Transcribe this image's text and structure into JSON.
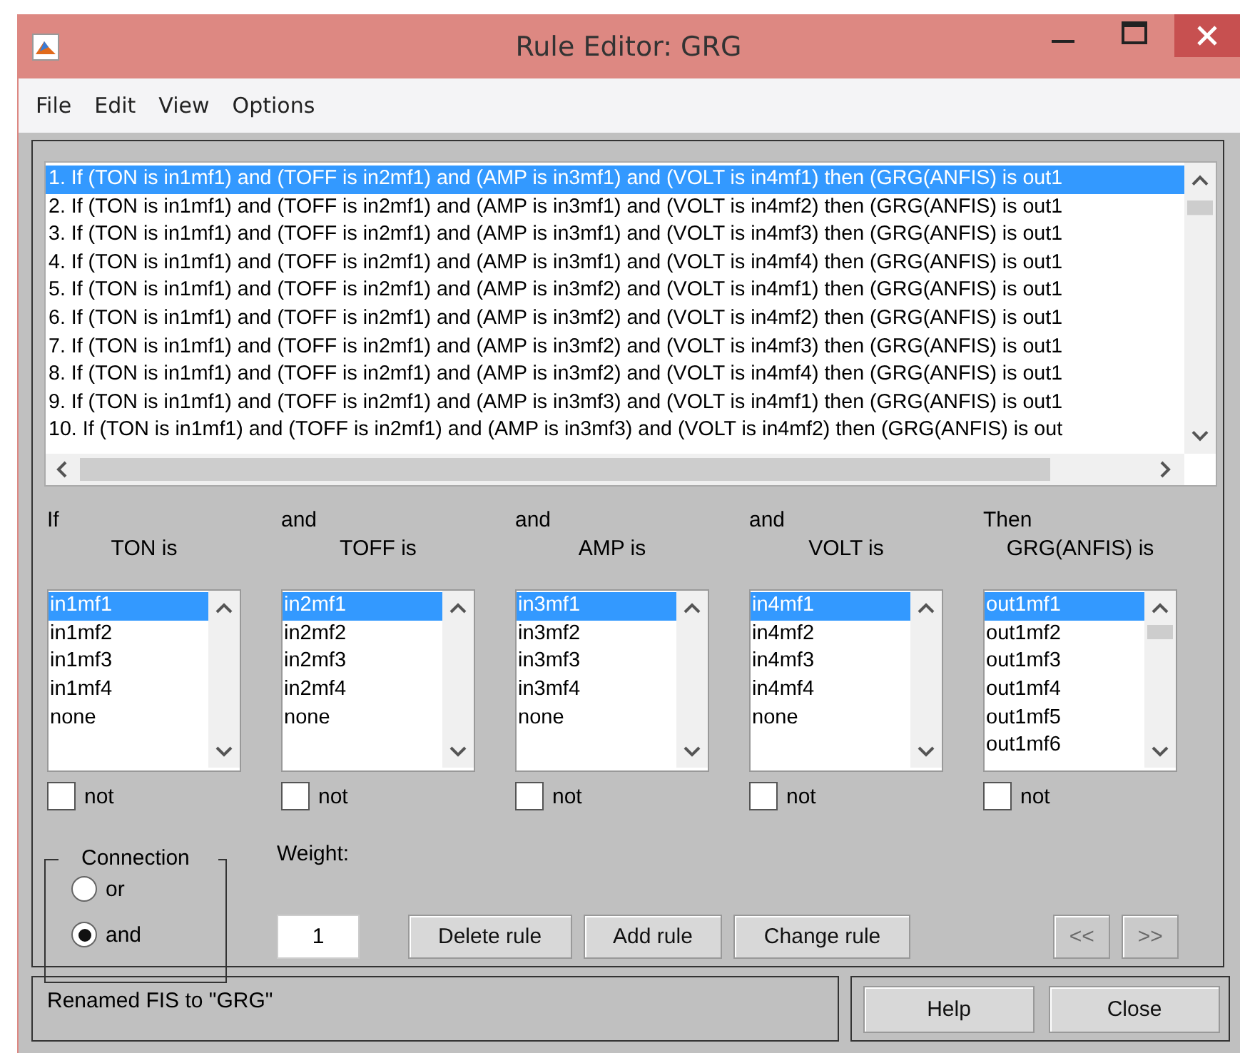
{
  "window": {
    "title": "Rule Editor: GRG"
  },
  "menu": [
    "File",
    "Edit",
    "View",
    "Options"
  ],
  "rules": [
    {
      "text": "1. If (TON is in1mf1) and (TOFF is in2mf1) and (AMP is in3mf1) and (VOLT is in4mf1) then (GRG(ANFIS) is out1",
      "selected": true
    },
    {
      "text": "2. If (TON is in1mf1) and (TOFF is in2mf1) and (AMP is in3mf1) and (VOLT is in4mf2) then (GRG(ANFIS) is out1",
      "selected": false
    },
    {
      "text": "3. If (TON is in1mf1) and (TOFF is in2mf1) and (AMP is in3mf1) and (VOLT is in4mf3) then (GRG(ANFIS) is out1",
      "selected": false
    },
    {
      "text": "4. If (TON is in1mf1) and (TOFF is in2mf1) and (AMP is in3mf1) and (VOLT is in4mf4) then (GRG(ANFIS) is out1",
      "selected": false
    },
    {
      "text": "5. If (TON is in1mf1) and (TOFF is in2mf1) and (AMP is in3mf2) and (VOLT is in4mf1) then (GRG(ANFIS) is out1",
      "selected": false
    },
    {
      "text": "6. If (TON is in1mf1) and (TOFF is in2mf1) and (AMP is in3mf2) and (VOLT is in4mf2) then (GRG(ANFIS) is out1",
      "selected": false
    },
    {
      "text": "7. If (TON is in1mf1) and (TOFF is in2mf1) and (AMP is in3mf2) and (VOLT is in4mf3) then (GRG(ANFIS) is out1",
      "selected": false
    },
    {
      "text": "8. If (TON is in1mf1) and (TOFF is in2mf1) and (AMP is in3mf2) and (VOLT is in4mf4) then (GRG(ANFIS) is out1",
      "selected": false
    },
    {
      "text": "9. If (TON is in1mf1) and (TOFF is in2mf1) and (AMP is in3mf3) and (VOLT is in4mf1) then (GRG(ANFIS) is out1",
      "selected": false
    },
    {
      "text": "10. If (TON is in1mf1) and (TOFF is in2mf1) and (AMP is in3mf3) and (VOLT is in4mf2) then (GRG(ANFIS) is out",
      "selected": false
    }
  ],
  "variables": [
    {
      "connector": "If",
      "label": "TON is",
      "items": [
        {
          "label": "in1mf1",
          "selected": true
        },
        {
          "label": "in1mf2",
          "selected": false
        },
        {
          "label": "in1mf3",
          "selected": false
        },
        {
          "label": "in1mf4",
          "selected": false
        },
        {
          "label": "none",
          "selected": false
        }
      ],
      "not": {
        "label": "not",
        "checked": false
      }
    },
    {
      "connector": "and",
      "label": "TOFF is",
      "items": [
        {
          "label": "in2mf1",
          "selected": true
        },
        {
          "label": "in2mf2",
          "selected": false
        },
        {
          "label": "in2mf3",
          "selected": false
        },
        {
          "label": "in2mf4",
          "selected": false
        },
        {
          "label": "none",
          "selected": false
        }
      ],
      "not": {
        "label": "not",
        "checked": false
      }
    },
    {
      "connector": "and",
      "label": "AMP is",
      "items": [
        {
          "label": "in3mf1",
          "selected": true
        },
        {
          "label": "in3mf2",
          "selected": false
        },
        {
          "label": "in3mf3",
          "selected": false
        },
        {
          "label": "in3mf4",
          "selected": false
        },
        {
          "label": "none",
          "selected": false
        }
      ],
      "not": {
        "label": "not",
        "checked": false
      }
    },
    {
      "connector": "and",
      "label": "VOLT is",
      "items": [
        {
          "label": "in4mf1",
          "selected": true
        },
        {
          "label": "in4mf2",
          "selected": false
        },
        {
          "label": "in4mf3",
          "selected": false
        },
        {
          "label": "in4mf4",
          "selected": false
        },
        {
          "label": "none",
          "selected": false
        }
      ],
      "not": {
        "label": "not",
        "checked": false
      }
    },
    {
      "connector": "Then",
      "label": "GRG(ANFIS) is",
      "items": [
        {
          "label": "out1mf1",
          "selected": true
        },
        {
          "label": "out1mf2",
          "selected": false
        },
        {
          "label": "out1mf3",
          "selected": false
        },
        {
          "label": "out1mf4",
          "selected": false
        },
        {
          "label": "out1mf5",
          "selected": false
        },
        {
          "label": "out1mf6",
          "selected": false
        }
      ],
      "not": {
        "label": "not",
        "checked": false
      }
    }
  ],
  "connection": {
    "title": "Connection",
    "options": [
      {
        "label": "or",
        "selected": false
      },
      {
        "label": "and",
        "selected": true
      }
    ]
  },
  "weight": {
    "label": "Weight:",
    "value": "1"
  },
  "buttons": [
    "Delete rule",
    "Add rule",
    "Change rule"
  ],
  "nav_buttons": [
    {
      "label": "<<",
      "disabled": true
    },
    {
      "label": ">>",
      "disabled": true
    }
  ],
  "status": "Renamed FIS to \"GRG\"",
  "footer_buttons": [
    "Help",
    "Close"
  ]
}
